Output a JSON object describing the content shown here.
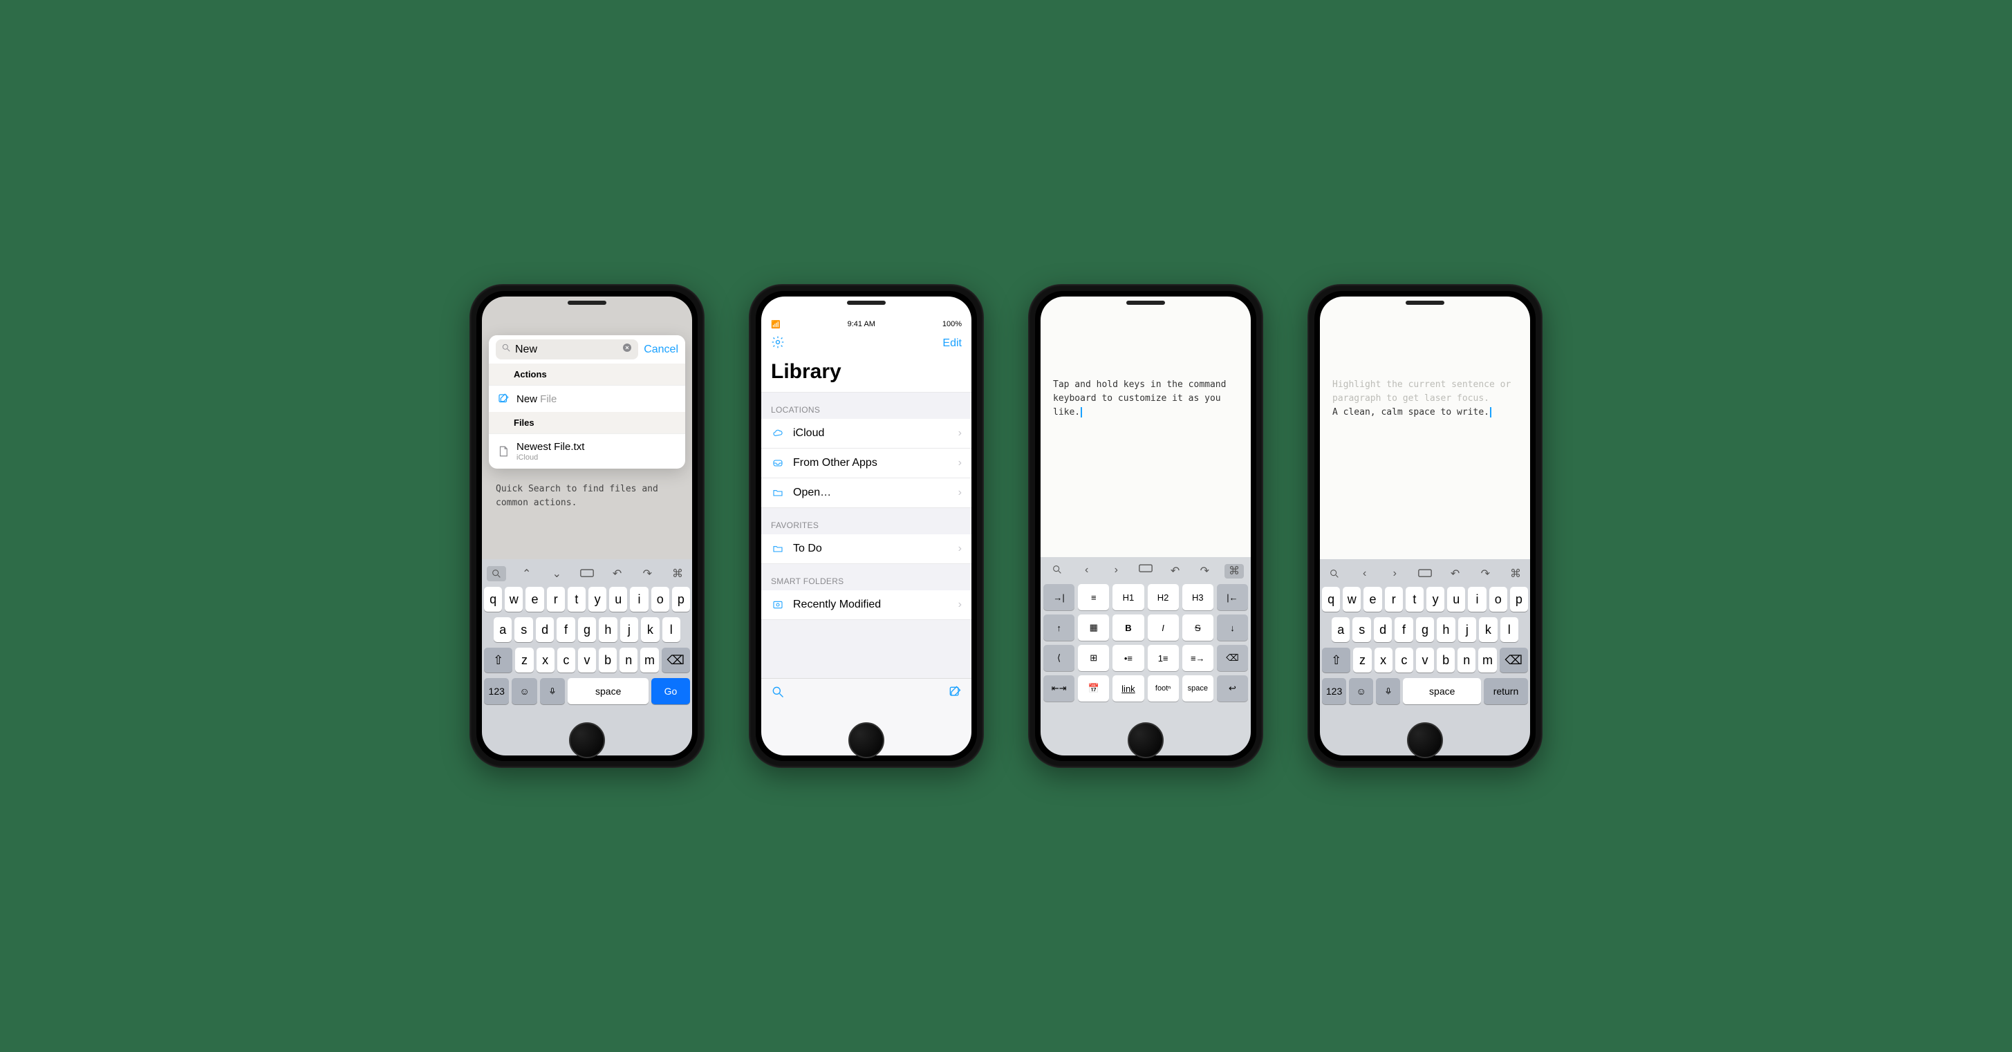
{
  "phone1": {
    "search": {
      "value": "New",
      "cancel": "Cancel"
    },
    "sections": {
      "actions": "Actions",
      "files": "Files"
    },
    "result1": {
      "prefix": "New",
      "suffix": " File"
    },
    "result2": {
      "title": "Newest File.txt",
      "sub": "iCloud"
    },
    "caption": "Quick Search to find files and common actions.",
    "keyboard": {
      "row1": [
        "q",
        "w",
        "e",
        "r",
        "t",
        "y",
        "u",
        "i",
        "o",
        "p"
      ],
      "row2": [
        "a",
        "s",
        "d",
        "f",
        "g",
        "h",
        "j",
        "k",
        "l"
      ],
      "row3": [
        "z",
        "x",
        "c",
        "v",
        "b",
        "n",
        "m"
      ],
      "num": "123",
      "space": "space",
      "go": "Go"
    }
  },
  "phone2": {
    "status": {
      "time": "9:41 AM",
      "battery": "100%"
    },
    "edit": "Edit",
    "title": "Library",
    "groups": {
      "locations": {
        "label": "LOCATIONS",
        "items": [
          "iCloud",
          "From Other Apps",
          "Open…"
        ]
      },
      "favorites": {
        "label": "FAVORITES",
        "items": [
          "To Do"
        ]
      },
      "smart": {
        "label": "SMART FOLDERS",
        "items": [
          "Recently Modified"
        ]
      }
    }
  },
  "phone3": {
    "text": "Tap and hold keys in the command keyboard to customize it as you like.",
    "cmdRows": [
      [
        "indent-right",
        "doc-outline",
        "H1",
        "H2",
        "H3",
        "indent-left"
      ],
      [
        "arrow-up",
        "image",
        "B",
        "I",
        "S",
        "arrow-down"
      ],
      [
        "back",
        "table",
        "list-ul",
        "list-ol",
        "list-indent",
        "backspace"
      ],
      [
        "tab-stops",
        "calendar",
        "link",
        "footn",
        "space",
        "return"
      ]
    ],
    "labels": {
      "H1": "H1",
      "H2": "H2",
      "H3": "H3",
      "B": "B",
      "I": "I",
      "S": "S",
      "link": "link",
      "footn": "footⁿ",
      "space": "space"
    }
  },
  "phone4": {
    "dim": "Highlight the current sentence or paragraph to get laser focus.",
    "text": "A clean, calm space to write.",
    "keyboard": {
      "row1": [
        "q",
        "w",
        "e",
        "r",
        "t",
        "y",
        "u",
        "i",
        "o",
        "p"
      ],
      "row2": [
        "a",
        "s",
        "d",
        "f",
        "g",
        "h",
        "j",
        "k",
        "l"
      ],
      "row3": [
        "z",
        "x",
        "c",
        "v",
        "b",
        "n",
        "m"
      ],
      "num": "123",
      "space": "space",
      "ret": "return"
    }
  }
}
